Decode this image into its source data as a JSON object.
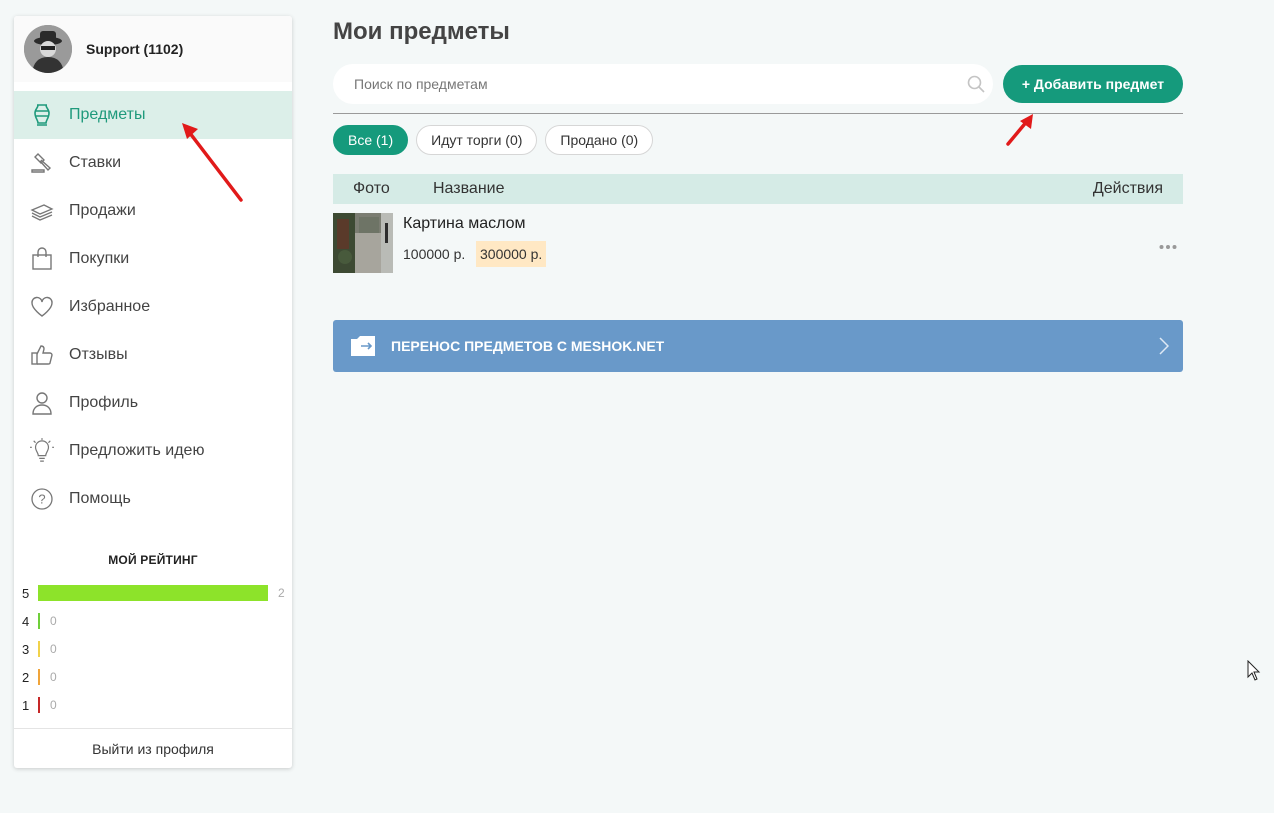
{
  "user": {
    "name": "Support (1102)",
    "avatar_icon": "detective-avatar"
  },
  "sidebar": {
    "items": [
      {
        "label": "Предметы",
        "icon": "vase-icon",
        "active": true
      },
      {
        "label": "Ставки",
        "icon": "gavel-icon"
      },
      {
        "label": "Продажи",
        "icon": "money-stack-icon"
      },
      {
        "label": "Покупки",
        "icon": "shopping-bag-icon"
      },
      {
        "label": "Избранное",
        "icon": "heart-icon"
      },
      {
        "label": "Отзывы",
        "icon": "thumbs-up-icon"
      },
      {
        "label": "Профиль",
        "icon": "user-icon"
      },
      {
        "label": "Предложить идею",
        "icon": "lightbulb-icon"
      },
      {
        "label": "Помощь",
        "icon": "help-icon"
      }
    ],
    "rating": {
      "title": "МОЙ РЕЙТИНГ",
      "rows": [
        {
          "star": "5",
          "count": "2",
          "color": "#8de32a"
        },
        {
          "star": "4",
          "count": "0",
          "color": "#6fcf3a"
        },
        {
          "star": "3",
          "count": "0",
          "color": "#f1d24a"
        },
        {
          "star": "2",
          "count": "0",
          "color": "#f0a43a"
        },
        {
          "star": "1",
          "count": "0",
          "color": "#c62828"
        }
      ]
    },
    "logout_label": "Выйти из профиля"
  },
  "main": {
    "title": "Мои предметы",
    "search": {
      "placeholder": "Поиск по предметам",
      "value": ""
    },
    "add_button": "+ Добавить предмет",
    "filters": [
      {
        "label": "Все (1)",
        "active": true
      },
      {
        "label": "Идут торги (0)"
      },
      {
        "label": "Продано (0)"
      }
    ],
    "table": {
      "columns": {
        "photo": "Фото",
        "name": "Название",
        "actions": "Действия"
      },
      "rows": [
        {
          "title": "Картина маслом",
          "price": "100000 р.",
          "reserve": "300000 р."
        }
      ]
    },
    "transfer_banner": "ПЕРЕНОС ПРЕДМЕТОВ С MESHOK.NET"
  },
  "colors": {
    "accent": "#159a7c",
    "active_bg": "#dcefe9",
    "table_head_bg": "#d5ebe6",
    "banner_bg": "#6999c9",
    "reserve_bg": "#ffe8c4",
    "annotation_red": "#e11a1a"
  }
}
